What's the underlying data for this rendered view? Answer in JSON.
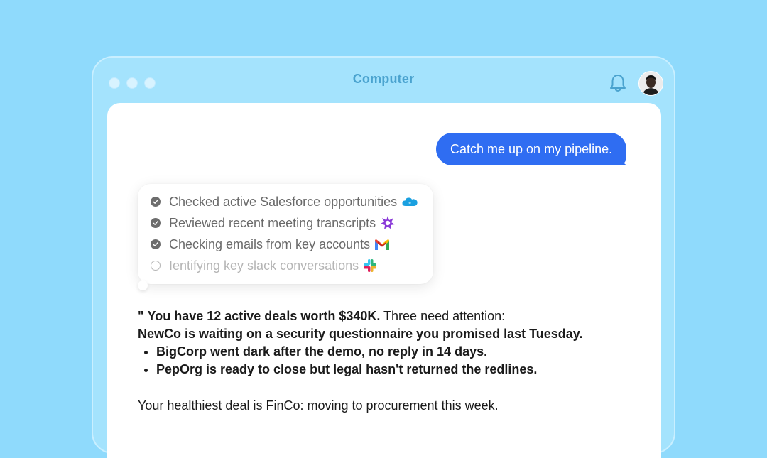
{
  "window": {
    "title": "Computer"
  },
  "chat": {
    "user_message": "Catch me up on my pipeline.",
    "tasks": [
      {
        "label": "Checked active Salesforce opportunities",
        "status": "done",
        "icon": "salesforce-icon"
      },
      {
        "label": "Reviewed recent meeting transcripts",
        "status": "done",
        "icon": "gong-icon"
      },
      {
        "label": "Checking emails from key accounts",
        "status": "done",
        "icon": "gmail-icon"
      },
      {
        "label": "Ientifying key slack conversations",
        "status": "pending",
        "icon": "slack-icon"
      }
    ],
    "answer": {
      "quote_mark": "\"",
      "lead_bold": "You have 12 active deals worth $340K.",
      "lead_rest": " Three need attention:",
      "line2": "NewCo is waiting on a security questionnaire you promised last Tuesday.",
      "bullets": [
        "BigCorp went dark after the demo, no reply in 14 days.",
        "PepOrg is ready to close but legal hasn't returned the redlines."
      ],
      "closing": "Your healthiest deal is FinCo: moving to procurement this week."
    }
  },
  "colors": {
    "background": "#8fdafc",
    "accent": "#2f6df2"
  }
}
